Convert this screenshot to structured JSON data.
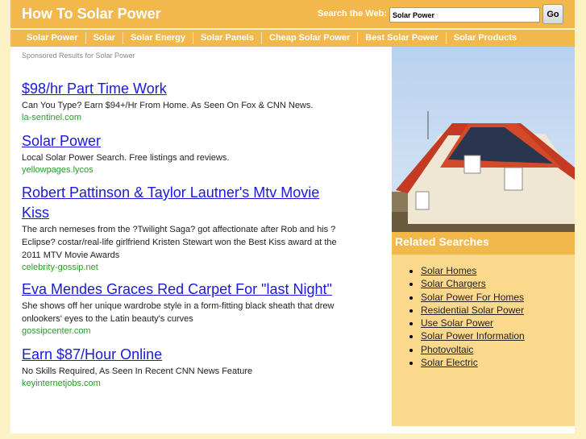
{
  "header": {
    "title": "How To Solar Power",
    "search_label": "Search the Web:",
    "search_value": "Solar Power",
    "go_label": "Go"
  },
  "nav": [
    "Solar Power",
    "Solar",
    "Solar Energy",
    "Solar Panels",
    "Cheap Solar Power",
    "Best Solar Power",
    "Solar Products"
  ],
  "main": {
    "sponsored": "Sponsored Results for Solar Power",
    "ads": [
      {
        "title": "$98/hr Part Time Work",
        "desc": "Can You Type? Earn $94+/Hr From Home. As Seen On Fox & CNN News.",
        "url": "la-sentinel.com"
      },
      {
        "title": "Solar Power",
        "desc": "Local Solar Power Search. Free listings and reviews.",
        "url": "yellowpages.lycos"
      },
      {
        "title": "Robert Pattinson & Taylor Lautner's Mtv Movie Kiss",
        "desc": "The arch nemeses from the ?Twilight Saga? got affectionate after Rob and his ?Eclipse? costar/real-life girlfriend Kristen Stewart won the Best Kiss award at the 2011 MTV Movie Awards",
        "url": "celebrity-gossip.net"
      },
      {
        "title": "Eva Mendes Graces Red Carpet For \"last Night\"",
        "desc": "She shows off her unique wardrobe style in a form-fitting black sheath that drew onlookers' eyes to the Latin beauty's curves",
        "url": "gossipcenter.com"
      },
      {
        "title": "Earn $87/Hour Online",
        "desc": "No Skills Required, As Seen In Recent CNN News Feature",
        "url": "keyinternetjobs.com"
      }
    ]
  },
  "sidebar": {
    "title": "Related Searches",
    "items": [
      "Solar Homes",
      "Solar Chargers",
      "Solar Power For Homes",
      "Residential Solar Power",
      "Use Solar Power",
      "Solar Power Information",
      "Photovoltaic",
      "Solar Electric"
    ]
  }
}
